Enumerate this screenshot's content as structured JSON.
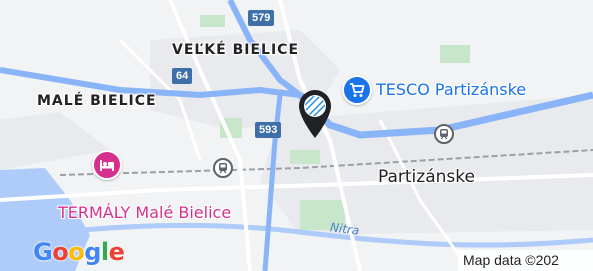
{
  "map": {
    "colors": {
      "land": "#f1f3f4",
      "urban": "#e8eaed",
      "water": "#aecbfa",
      "park": "#c8e6c9",
      "highway": "#8ab4f8",
      "road": "#ffffff",
      "road_shield": "#3f6fa8",
      "tesco_marker": "#1a73e8",
      "hotel_marker": "#d6308e"
    },
    "road_shields": [
      {
        "id": "579",
        "label": "579"
      },
      {
        "id": "64",
        "label": "64"
      },
      {
        "id": "593",
        "label": "593"
      }
    ],
    "places": [
      {
        "id": "velke-bielice",
        "label": "VEĽKÉ BIELICE"
      },
      {
        "id": "male-bielice",
        "label": "MALÉ BIELICE"
      },
      {
        "id": "partizanske",
        "label": "Partizánske"
      }
    ],
    "pois": {
      "tesco": {
        "label": "TESCO Partizánske",
        "icon": "shopping-cart-icon"
      },
      "hotel": {
        "label": "TERMÁLY Malé Bielice",
        "icon": "hotel-bed-icon"
      },
      "location_pin": {
        "icon": "location-pin-icon",
        "badge_icon": "bavarian-flag-icon"
      }
    },
    "river": {
      "label": "Nitra"
    },
    "transit_stations": [
      {
        "id": "station-east",
        "icon": "train-station-icon"
      },
      {
        "id": "station-west",
        "icon": "train-station-icon"
      }
    ],
    "branding": {
      "logo": "Google",
      "logo_letter_colors": [
        "#4285f4",
        "#ea4335",
        "#fbbc05",
        "#4285f4",
        "#34a853",
        "#ea4335"
      ],
      "attribution": "Map data ©202"
    }
  }
}
